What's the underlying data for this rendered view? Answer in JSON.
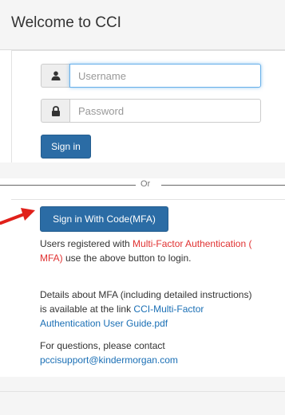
{
  "header": {
    "title": "Welcome to CCI"
  },
  "login": {
    "username_placeholder": "Username",
    "password_placeholder": "Password",
    "signin_label": "Sign in"
  },
  "divider": {
    "label": "Or"
  },
  "mfa": {
    "button_label": "Sign in With Code(MFA)",
    "p1_text1": "Users registered with ",
    "p1_highlight": "Multi-Factor Authentication ( MFA)",
    "p1_text2": " use the above button to login.",
    "p2_text": "Details about MFA (including detailed instructions) is available at the link ",
    "p2_link": "CCI-Multi-Factor Authentication User Guide.pdf",
    "p3_text": "For questions, please contact ",
    "p3_email": "pccisupport@kindermorgan.com"
  },
  "colors": {
    "primary": "#2b6ca5",
    "highlight": "#e03131",
    "link": "#1a6fb5",
    "arrow": "#e0201a"
  },
  "icons": {
    "username": "user-icon",
    "password": "lock-icon",
    "pointer": "arrow-icon"
  }
}
